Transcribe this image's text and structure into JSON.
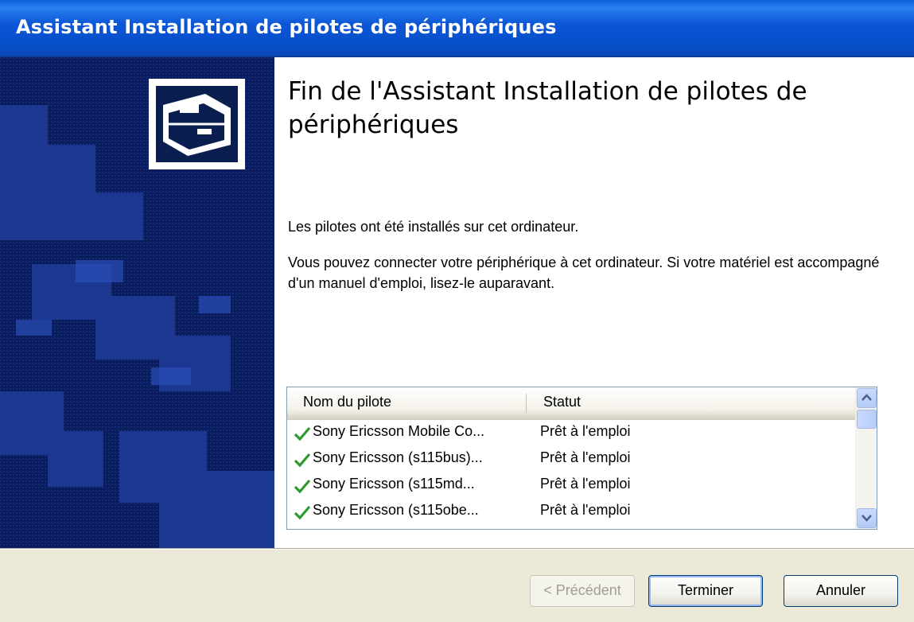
{
  "window": {
    "title": "Assistant Installation de pilotes de périphériques"
  },
  "content": {
    "heading": "Fin de l'Assistant Installation de pilotes de périphériques",
    "message_installed": "Les pilotes ont été installés sur cet ordinateur.",
    "message_connect": "Vous pouvez connecter votre périphérique à cet ordinateur. Si votre matériel est accompagné d'un manuel d'emploi, lisez-le auparavant."
  },
  "driver_list": {
    "columns": [
      "Nom du pilote",
      "Statut"
    ],
    "rows": [
      {
        "name": "Sony Ericsson Mobile Co...",
        "status": "Prêt à l'emploi",
        "icon": "green-check-icon"
      },
      {
        "name": "Sony Ericsson (s115bus)...",
        "status": "Prêt à l'emploi",
        "icon": "green-check-icon"
      },
      {
        "name": "Sony Ericsson (s115md...",
        "status": "Prêt à l'emploi",
        "icon": "green-check-icon"
      },
      {
        "name": "Sony Ericsson (s115obe...",
        "status": "Prêt à l'emploi",
        "icon": "green-check-icon"
      }
    ]
  },
  "buttons": {
    "back": "< Précédent",
    "finish": "Terminer",
    "cancel": "Annuler"
  },
  "colors": {
    "titlebar": "#0750cc",
    "sidebar": "#081a54",
    "check": "#2e9a2e"
  }
}
